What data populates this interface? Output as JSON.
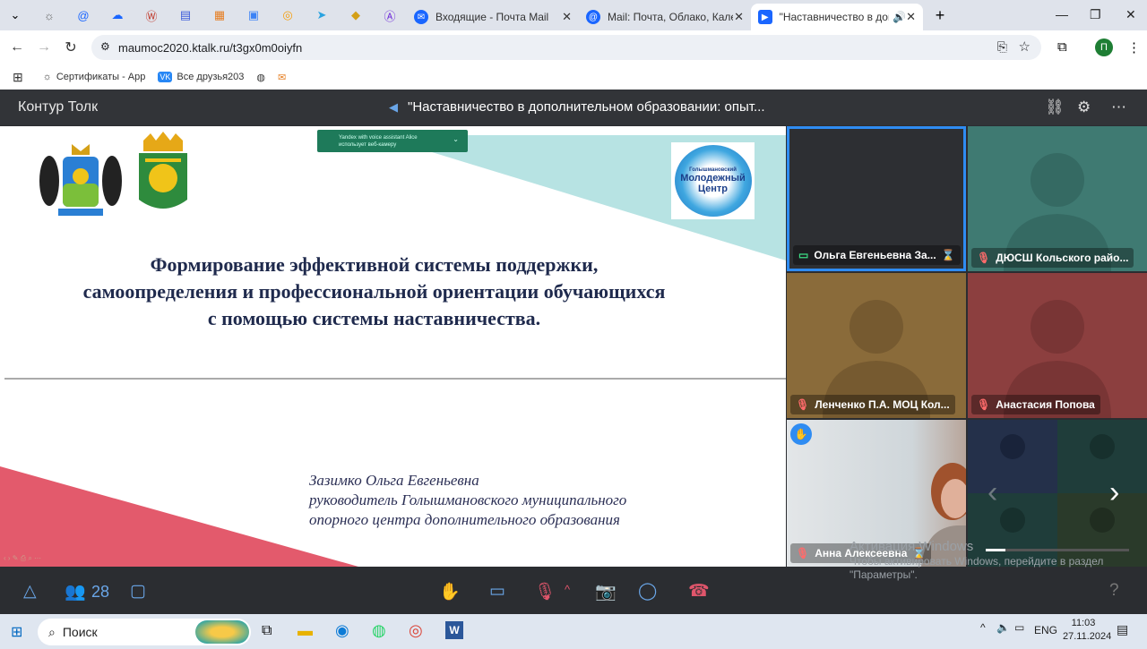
{
  "browser": {
    "tabs": [
      {
        "label": "Входящие - Почта Mail"
      },
      {
        "label": "Mail: Почта, Облако, Календар"
      },
      {
        "label": "\"Наставничество в дополн"
      }
    ],
    "url": "maumoc2020.ktalk.ru/t3gx0m0oiyfn",
    "profile_initial": "П",
    "bookmarks": [
      {
        "label": "Сертификаты - App"
      },
      {
        "label": "Все друзья203"
      }
    ]
  },
  "app": {
    "brand": "Контур Толк",
    "meeting_title": "\"Наставничество в дополнительном образовании: опыт...",
    "participants_count": "28"
  },
  "slide": {
    "camera_notice_line1": "Yandex with voice assistant Alice",
    "camera_notice_line2": "использует веб-камеру",
    "logo_text": "Молодежный Центр",
    "logo_small": "Голышмановский",
    "title_line1": "Формирование эффективной системы поддержки,",
    "title_line2": "самоопределения и профессиональной ориентации обучающихся",
    "title_line3": "с помощью системы наставничества.",
    "author_line1": "Зазимко Ольга Евгеньевна",
    "author_line2": "руководитель Голышмановского  муниципального",
    "author_line3": "опорного центра дополнительного образования"
  },
  "participants": [
    {
      "name": "Ольга Евгеньевна За...",
      "bg": "#2d2f33"
    },
    {
      "name": "ДЮСШ Кольского райо...",
      "bg": "#3f7a72"
    },
    {
      "name": "Ленченко П.А. МОЦ Кол...",
      "bg": "#8a6b3a"
    },
    {
      "name": "Анастасия Попова",
      "bg": "#8c3f3f"
    },
    {
      "name": "Анна Алексеевна",
      "bg": "#d9dde0"
    }
  ],
  "windows_watermark": {
    "line1": "Активация Windows",
    "line2": "Чтобы активировать Windows, перейдите в раздел",
    "line3": "\"Параметры\"."
  },
  "taskbar": {
    "search_placeholder": "Поиск",
    "lang": "ENG",
    "time": "11:03",
    "date": "27.11.2024"
  },
  "colors": {
    "accent": "#1a73e8",
    "slide_teal": "#b7e3e3",
    "slide_red": "#e35a6c",
    "title_navy": "#1f2a4d"
  }
}
